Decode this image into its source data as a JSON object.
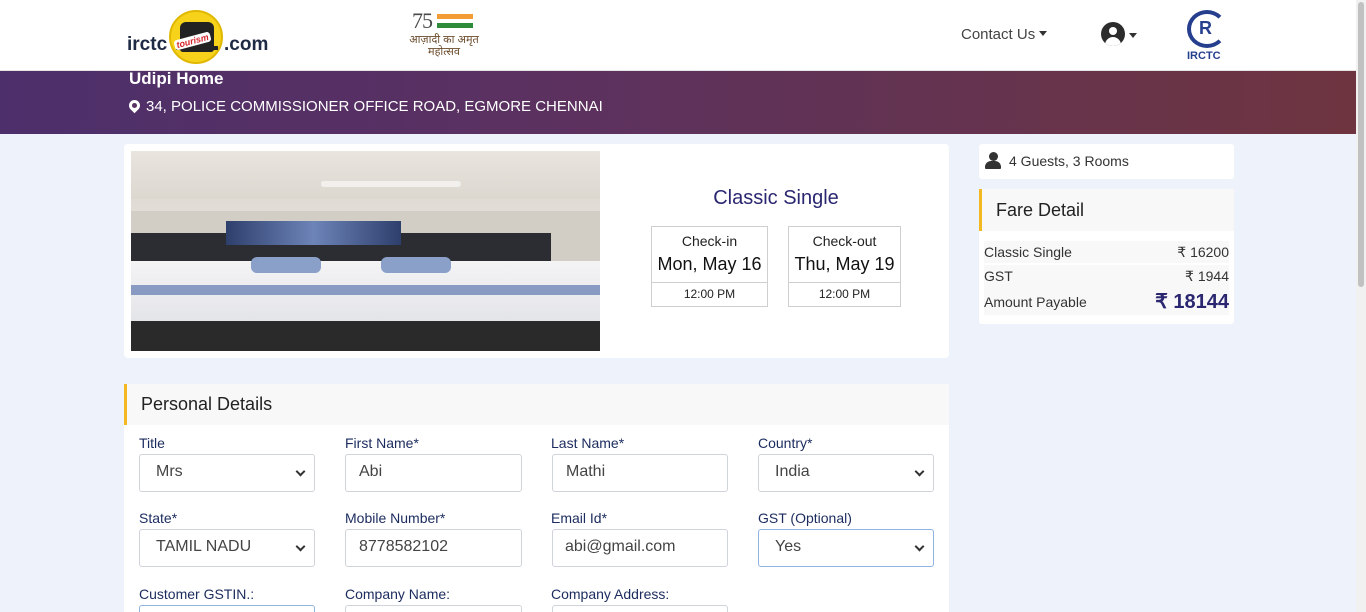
{
  "header": {
    "logo_left": "irctc",
    "logo_right": ".com",
    "logo_badge": "tourism",
    "azadi_number": "75",
    "azadi_text": "आज़ादी का अमृत महोत्सव",
    "contact_label": "Contact Us",
    "irctc_label": "IRCTC"
  },
  "hotel": {
    "name": "Udipi Home",
    "address": "34, POLICE COMMISSIONER OFFICE ROAD, EGMORE CHENNAI"
  },
  "room": {
    "title": "Classic Single",
    "checkin": {
      "label": "Check-in",
      "date": "Mon, May 16",
      "time": "12:00 PM"
    },
    "checkout": {
      "label": "Check-out",
      "date": "Thu, May 19",
      "time": "12:00 PM"
    }
  },
  "guests": {
    "summary": "4 Guests, 3 Rooms"
  },
  "fare": {
    "title": "Fare Detail",
    "rows": [
      {
        "label": "Classic Single",
        "value": "₹ 16200"
      },
      {
        "label": "GST",
        "value": "₹ 1944"
      }
    ],
    "total_label": "Amount Payable",
    "total_value": "₹ 18144"
  },
  "personal": {
    "title": "Personal Details",
    "fields": {
      "title": {
        "label": "Title",
        "value": "Mrs"
      },
      "first_name": {
        "label": "First Name*",
        "value": "Abi"
      },
      "last_name": {
        "label": "Last Name*",
        "value": "Mathi"
      },
      "country": {
        "label": "Country*",
        "value": "India"
      },
      "state": {
        "label": "State*",
        "value": "TAMIL NADU"
      },
      "mobile": {
        "label": "Mobile Number*",
        "value": "8778582102"
      },
      "email": {
        "label": "Email Id*",
        "value": "abi@gmail.com"
      },
      "gst": {
        "label": "GST (Optional)",
        "value": "Yes"
      },
      "gstin": {
        "label": "Customer GSTIN.:",
        "value": ""
      },
      "company_name": {
        "label": "Company Name:",
        "value": ""
      },
      "company_address": {
        "label": "Company Address:",
        "value": ""
      }
    }
  },
  "colors": {
    "accent": "#f4b922",
    "brand_navy": "#2a2770",
    "banner_start": "#4d2f6b",
    "banner_end": "#6e3540"
  }
}
